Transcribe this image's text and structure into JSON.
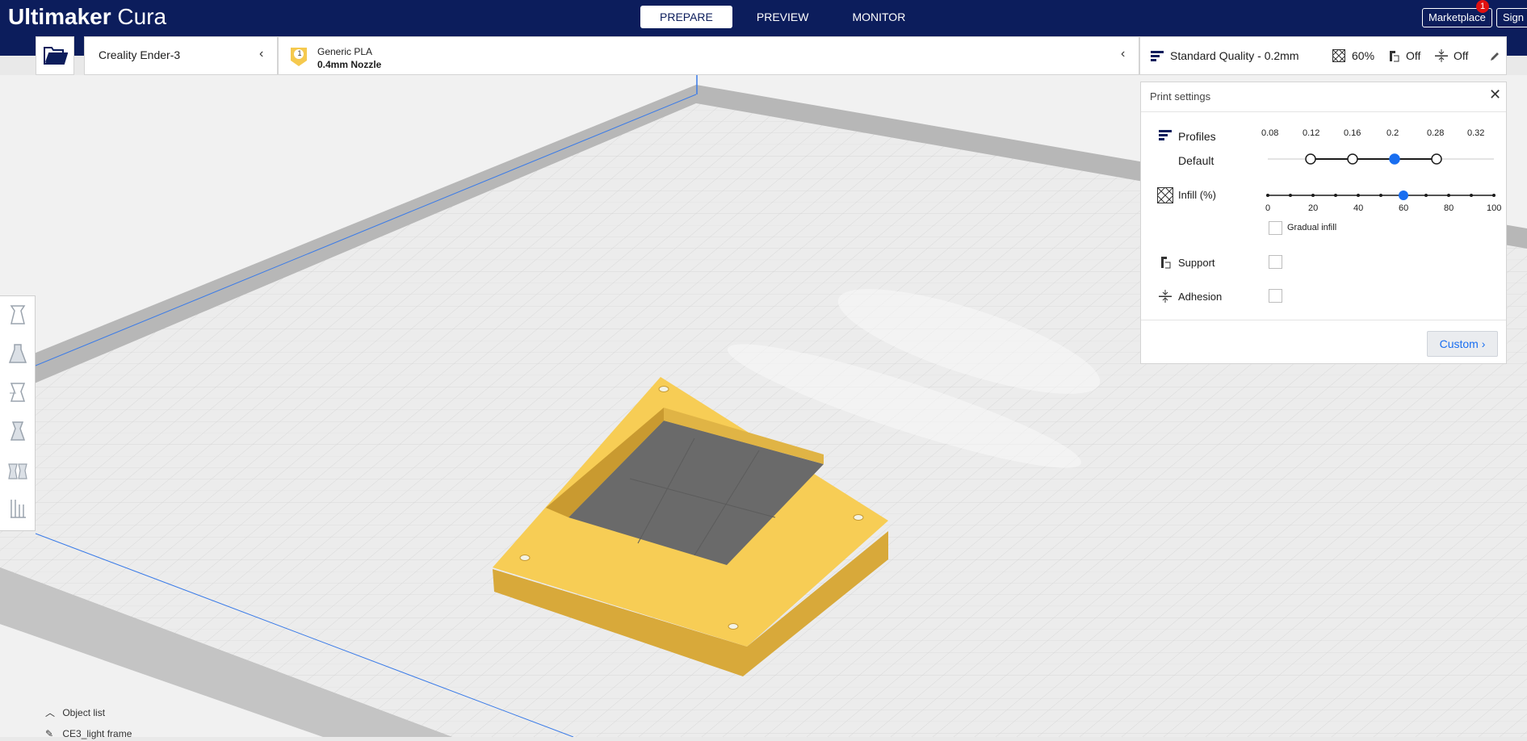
{
  "app": {
    "brand_bold": "Ultimaker",
    "brand_light": " Cura"
  },
  "stages": {
    "prepare": "PREPARE",
    "preview": "PREVIEW",
    "monitor": "MONITOR",
    "active": "PREPARE"
  },
  "header": {
    "marketplace": "Marketplace",
    "marketplace_badge": "1",
    "sign_in": "Sign in"
  },
  "printer": {
    "name": "Creality Ender-3"
  },
  "material": {
    "extruder_number": "1",
    "name": "Generic PLA",
    "nozzle": "0.4mm Nozzle"
  },
  "settings_summary": {
    "quality": "Standard Quality - 0.2mm",
    "infill": "60%",
    "support": "Off",
    "adhesion": "Off"
  },
  "print_settings": {
    "title": "Print settings",
    "profiles_label": "Profiles",
    "profile_name": "Default",
    "layer_heights": [
      "0.08",
      "0.12",
      "0.16",
      "0.2",
      "0.28",
      "0.32"
    ],
    "selected_layer_height": "0.2",
    "infill_label": "Infill (%)",
    "infill_ticks": [
      "0",
      "20",
      "40",
      "60",
      "80",
      "100"
    ],
    "infill_value": 60,
    "gradual_infill_label": "Gradual infill",
    "gradual_infill_checked": false,
    "support_label": "Support",
    "support_checked": false,
    "adhesion_label": "Adhesion",
    "adhesion_checked": false,
    "custom_button": "Custom"
  },
  "object_list": {
    "label": "Object list",
    "file": "CE3_light frame"
  },
  "colors": {
    "header_bg": "#0c1d5c",
    "accent": "#196ef0",
    "model": "#f5c94e",
    "badge": "#e01010"
  },
  "toolbar_icons": [
    "move-icon",
    "scale-icon",
    "rotate-icon",
    "mirror-icon",
    "per-model-settings-icon",
    "support-blocker-icon"
  ]
}
